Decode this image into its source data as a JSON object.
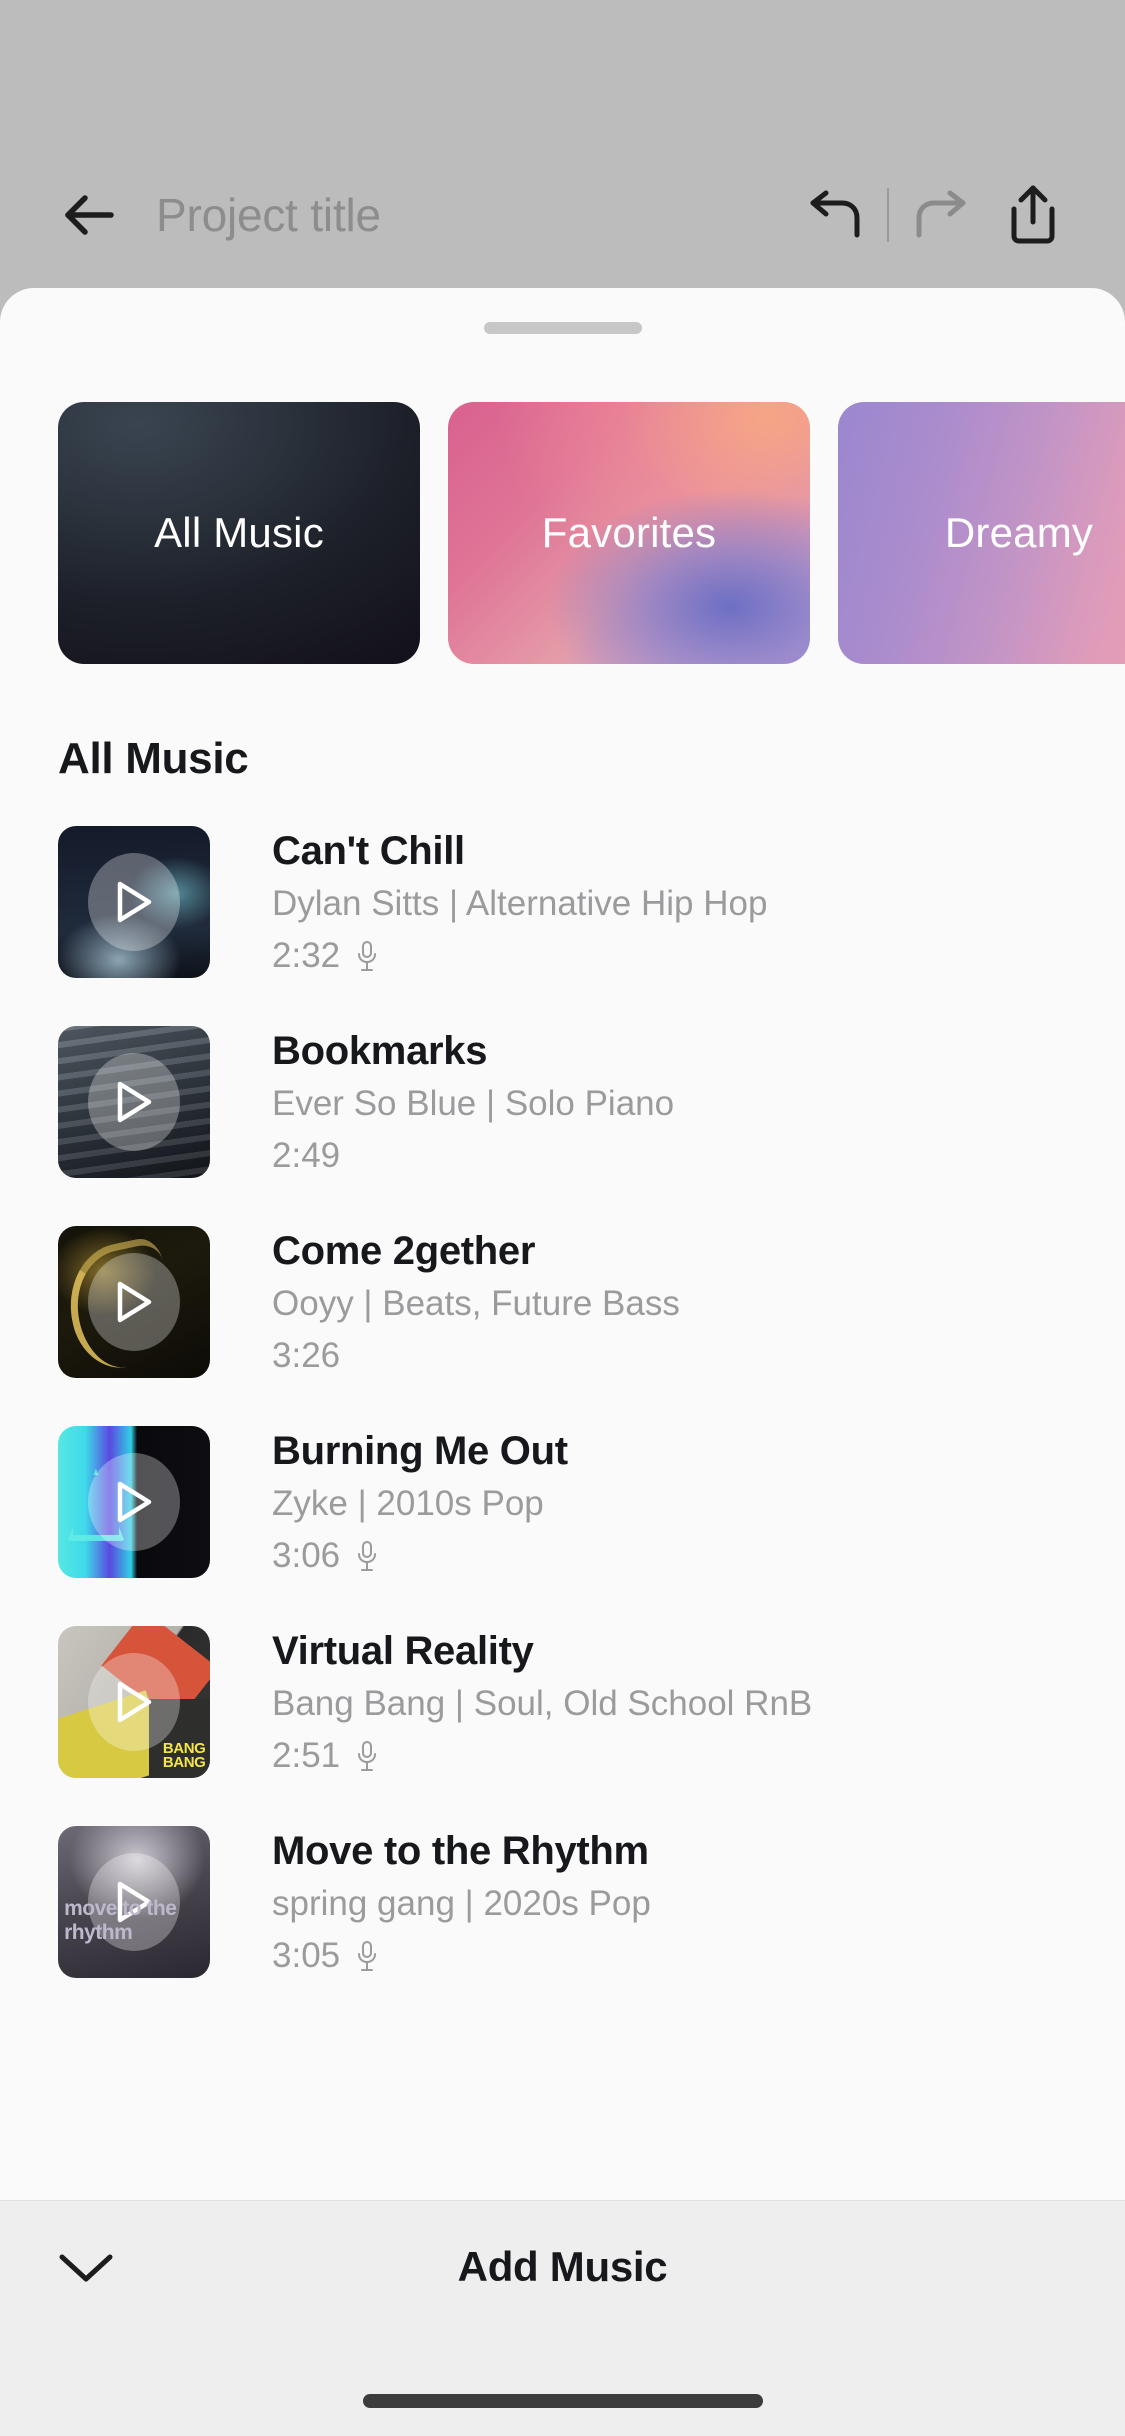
{
  "header": {
    "back_icon": "arrow-left-icon",
    "project_title": "Project title",
    "undo_icon": "undo-arrow-icon",
    "redo_icon": "redo-arrow-icon",
    "share_icon": "share-export-icon"
  },
  "sheet": {
    "drag_handle": "drag-handle"
  },
  "categories": [
    {
      "label": "All Music",
      "style": "card-allmusic",
      "selected": true
    },
    {
      "label": "Favorites",
      "style": "card-favorites",
      "selected": false
    },
    {
      "label": "Dreamy",
      "style": "card-dreamy",
      "selected": false
    }
  ],
  "section": {
    "title": "All Music"
  },
  "tracks": [
    {
      "title": "Can't Chill",
      "meta": "Dylan Sitts | Alternative Hip Hop",
      "artist": "Dylan Sitts",
      "genre": "Alternative Hip Hop",
      "duration": "2:32",
      "has_vocals": true,
      "art": "art-cantchill",
      "art_text": ""
    },
    {
      "title": "Bookmarks",
      "meta": "Ever So Blue | Solo Piano",
      "artist": "Ever So Blue",
      "genre": "Solo Piano",
      "duration": "2:49",
      "has_vocals": false,
      "art": "art-bookmarks",
      "art_text": ""
    },
    {
      "title": "Come 2gether",
      "meta": "Ooyy | Beats, Future Bass",
      "artist": "Ooyy",
      "genre": "Beats, Future Bass",
      "duration": "3:26",
      "has_vocals": false,
      "art": "art-come2gether",
      "art_text": ""
    },
    {
      "title": "Burning Me Out",
      "meta": "Zyke | 2010s Pop",
      "artist": "Zyke",
      "genre": "2010s Pop",
      "duration": "3:06",
      "has_vocals": true,
      "art": "art-burning",
      "art_text": ""
    },
    {
      "title": "Virtual Reality",
      "meta": "Bang Bang | Soul, Old School RnB",
      "artist": "Bang Bang",
      "genre": "Soul, Old School RnB",
      "duration": "2:51",
      "has_vocals": true,
      "art": "art-virtual",
      "art_text": "BANG\nBANG"
    },
    {
      "title": "Move to the Rhythm",
      "meta": "spring gang | 2020s Pop",
      "artist": "spring gang",
      "genre": "2020s Pop",
      "duration": "3:05",
      "has_vocals": true,
      "art": "art-move",
      "art_text": "move to the rhythm"
    }
  ],
  "bottom_bar": {
    "collapse_icon": "chevron-down-icon",
    "add_music_label": "Add Music",
    "home_indicator": "home-indicator"
  },
  "colors": {
    "sheet_bg": "#fafafa",
    "header_bg": "#bcbcbc",
    "bottom_bar_bg": "#eeeeee",
    "text_primary": "#16181c",
    "text_secondary": "#9b9b9e",
    "placeholder": "#8d8d8d"
  }
}
